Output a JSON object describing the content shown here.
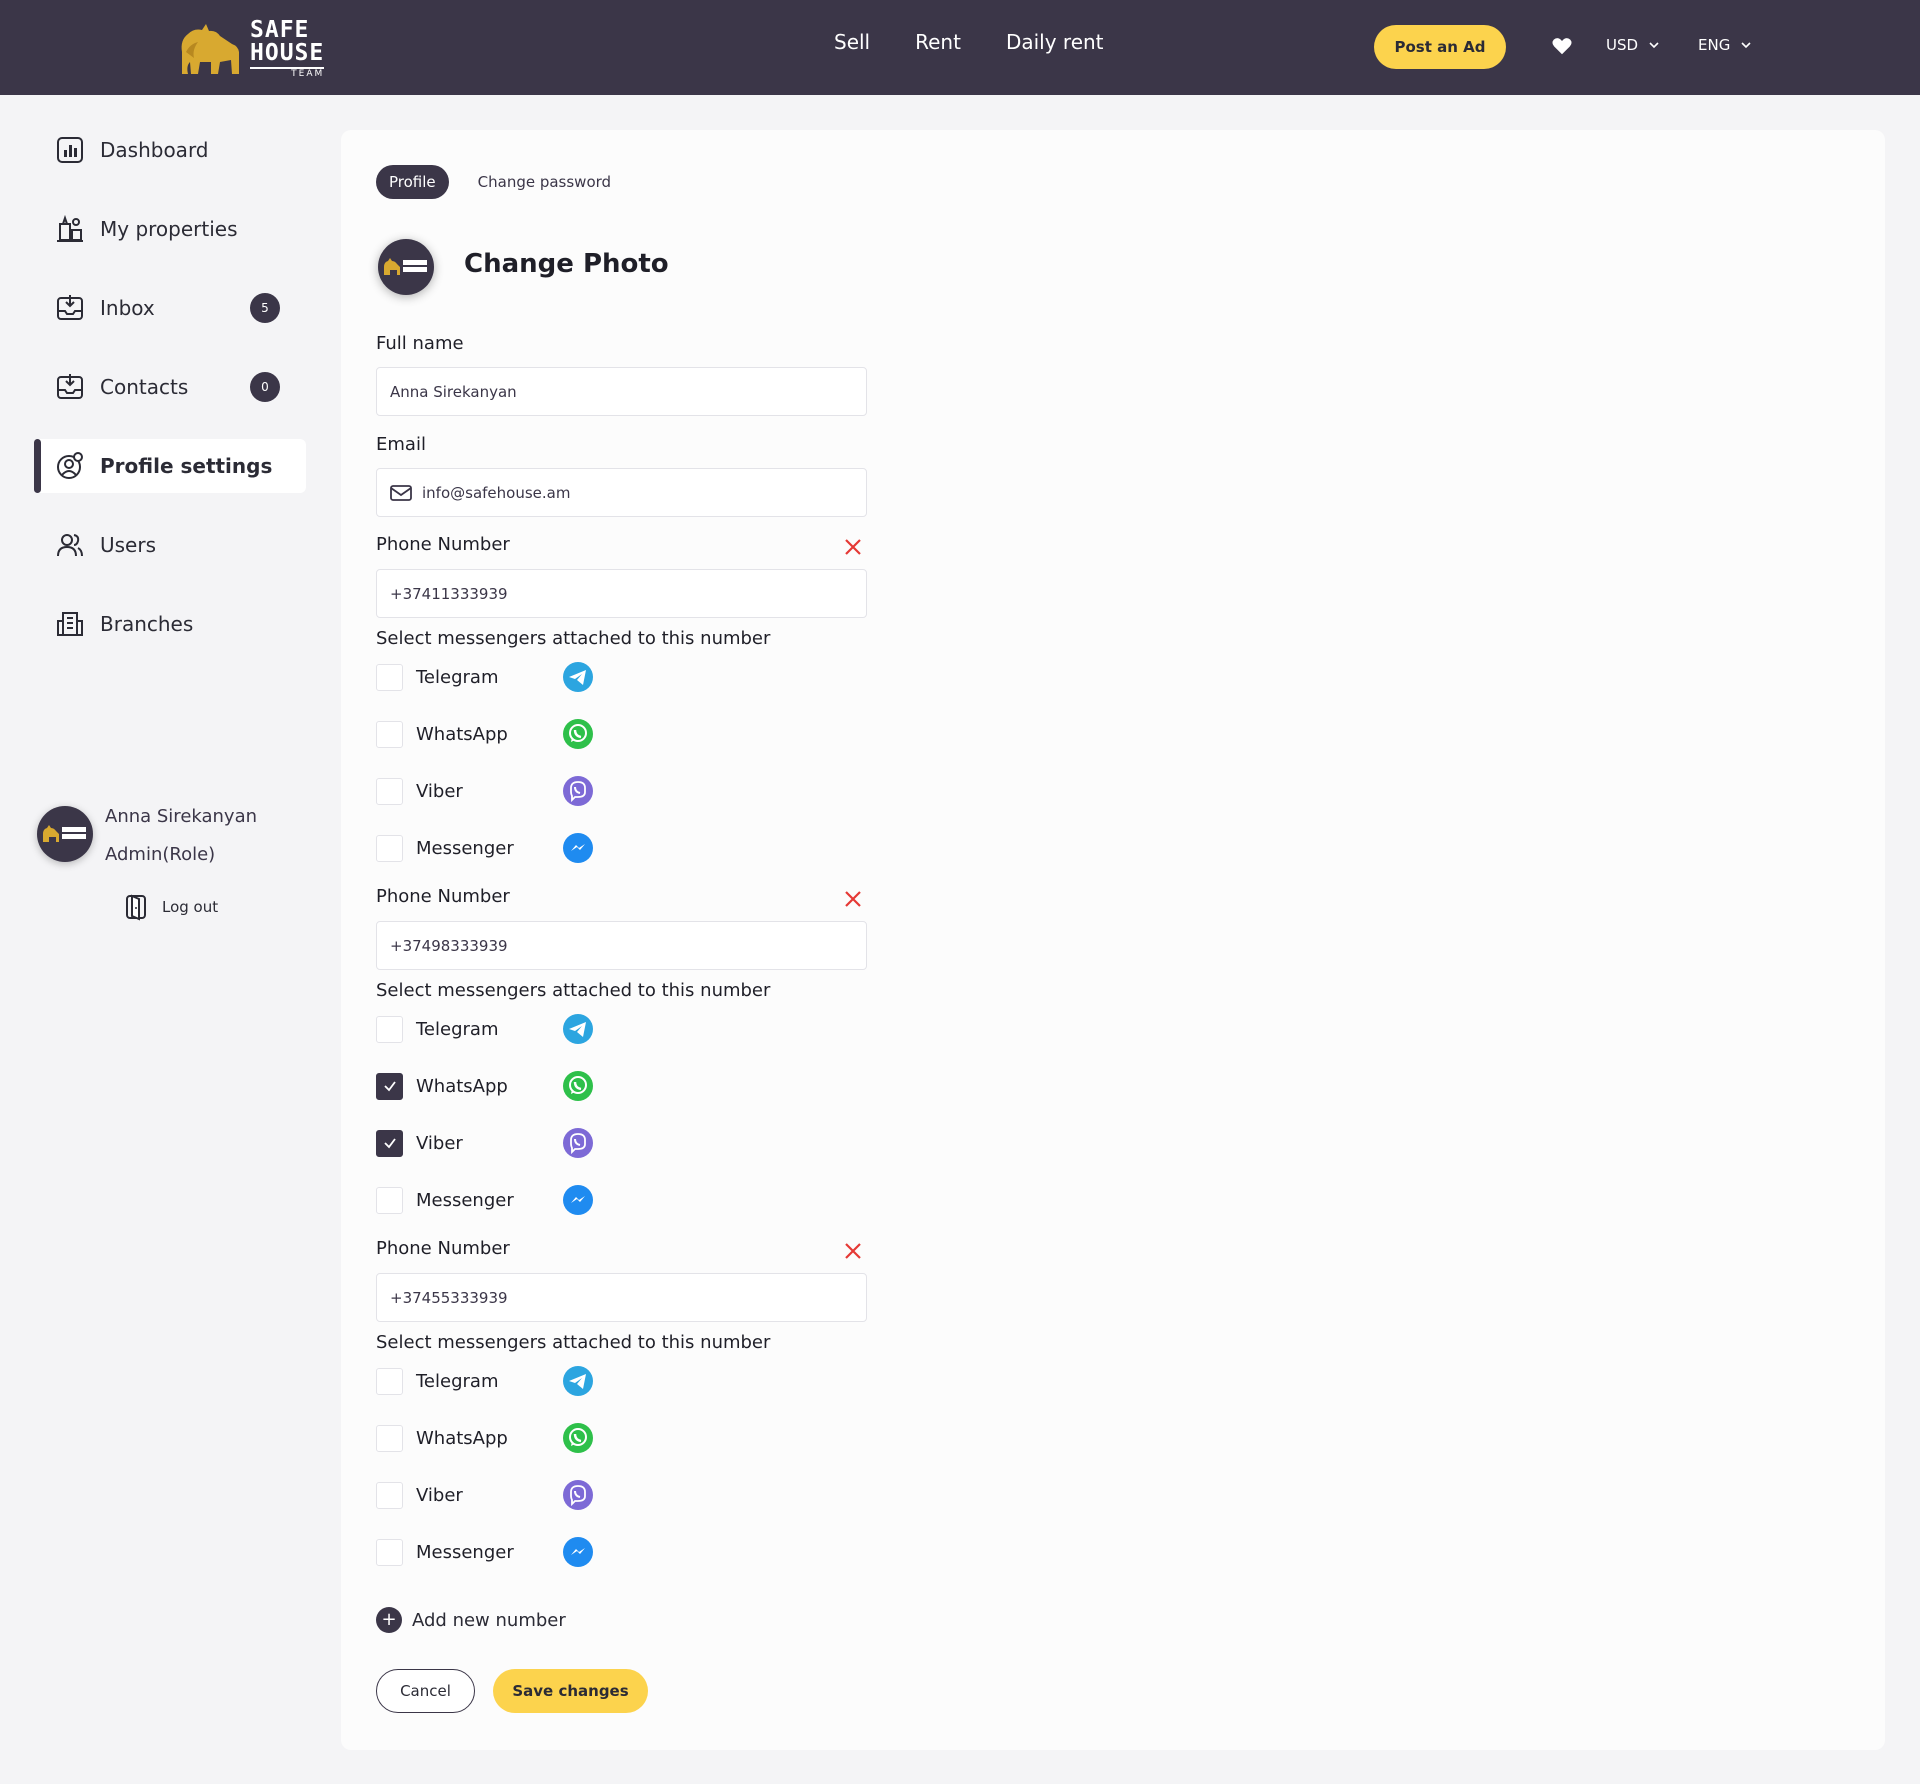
{
  "header": {
    "logo_line1": "SAFE",
    "logo_line2": "HOUSE",
    "logo_line3": "TEAM",
    "nav": [
      "Sell",
      "Rent",
      "Daily rent"
    ],
    "post_ad": "Post an Ad",
    "currency": "USD",
    "language": "ENG"
  },
  "sidebar": {
    "items": [
      {
        "label": "Dashboard",
        "icon": "dashboard-icon"
      },
      {
        "label": "My properties",
        "icon": "properties-icon"
      },
      {
        "label": "Inbox",
        "icon": "inbox-icon",
        "badge": "5"
      },
      {
        "label": "Contacts",
        "icon": "contacts-icon",
        "badge": "0"
      },
      {
        "label": "Profile settings",
        "icon": "profile-settings-icon",
        "active": true
      },
      {
        "label": "Users",
        "icon": "users-icon"
      },
      {
        "label": "Branches",
        "icon": "branches-icon"
      }
    ],
    "user_name": "Anna Sirekanyan",
    "user_role": "Admin(Role)",
    "logout": "Log out"
  },
  "tabs": {
    "profile": "Profile",
    "change_password": "Change password"
  },
  "form": {
    "change_photo": "Change Photo",
    "full_name_label": "Full name",
    "full_name_value": "Anna Sirekanyan",
    "email_label": "Email",
    "email_value": "info@safehouse.am",
    "phone_label": "Phone Number",
    "messengers_label": "Select messengers attached to this number",
    "messenger_names": [
      "Telegram",
      "WhatsApp",
      "Viber",
      "Messenger"
    ],
    "phones": [
      {
        "number": "+37411333939",
        "checked": [
          false,
          false,
          false,
          false
        ]
      },
      {
        "number": "+37498333939",
        "checked": [
          false,
          true,
          true,
          false
        ]
      },
      {
        "number": "+37455333939",
        "checked": [
          false,
          false,
          false,
          false
        ]
      }
    ],
    "add_number": "Add new number",
    "cancel": "Cancel",
    "save": "Save changes"
  },
  "colors": {
    "header_bg": "#3b3648",
    "accent_yellow": "#fcd34d",
    "remove_red": "#e53935",
    "telegram": "#2ca5e0",
    "whatsapp": "#2ec04a",
    "viber": "#7d6ad6",
    "messenger": "#1f8bf0"
  }
}
